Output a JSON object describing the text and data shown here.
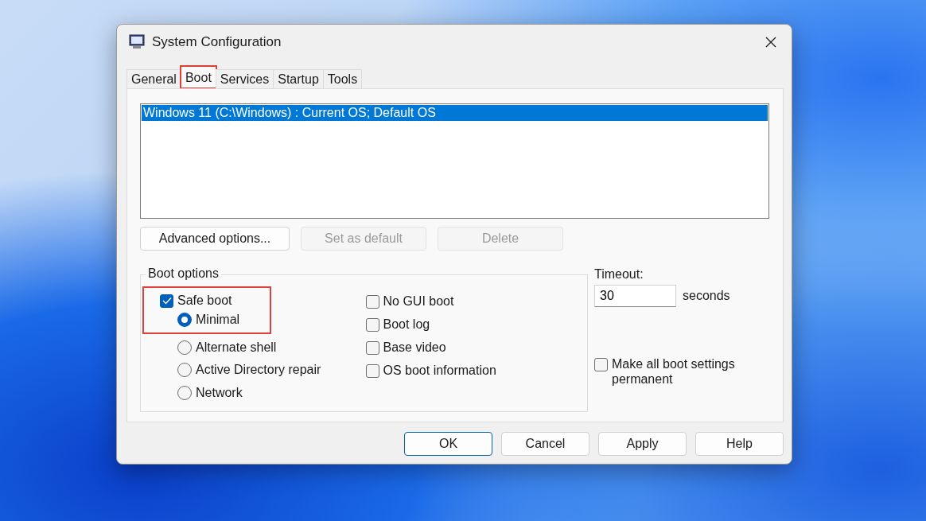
{
  "window": {
    "title": "System Configuration"
  },
  "tabs": [
    {
      "label": "General",
      "selected": false,
      "highlighted": false
    },
    {
      "label": "Boot",
      "selected": true,
      "highlighted": true
    },
    {
      "label": "Services",
      "selected": false,
      "highlighted": false
    },
    {
      "label": "Startup",
      "selected": false,
      "highlighted": false
    },
    {
      "label": "Tools",
      "selected": false,
      "highlighted": false
    }
  ],
  "os_list": [
    {
      "label": "Windows 11 (C:\\Windows) : Current OS; Default OS",
      "selected": true
    }
  ],
  "list_buttons": [
    {
      "label": "Advanced options...",
      "disabled": false
    },
    {
      "label": "Set as default",
      "disabled": true
    },
    {
      "label": "Delete",
      "disabled": true
    }
  ],
  "boot_options": {
    "title": "Boot options",
    "safe_boot": {
      "label": "Safe boot",
      "checked": true,
      "highlighted": true
    },
    "safe_modes": [
      {
        "label": "Minimal",
        "selected": true
      },
      {
        "label": "Alternate shell",
        "selected": false
      },
      {
        "label": "Active Directory repair",
        "selected": false
      },
      {
        "label": "Network",
        "selected": false
      }
    ],
    "flags": [
      {
        "label": "No GUI boot",
        "checked": false
      },
      {
        "label": "Boot log",
        "checked": false
      },
      {
        "label": "Base video",
        "checked": false
      },
      {
        "label": "OS boot information",
        "checked": false
      }
    ]
  },
  "timeout": {
    "label": "Timeout:",
    "value": "30",
    "unit": "seconds"
  },
  "permanent": {
    "label": "Make all boot settings permanent",
    "checked": false
  },
  "dialog_buttons": [
    {
      "label": "OK",
      "default": true
    },
    {
      "label": "Cancel",
      "default": false
    },
    {
      "label": "Apply",
      "default": false
    },
    {
      "label": "Help",
      "default": false
    }
  ]
}
